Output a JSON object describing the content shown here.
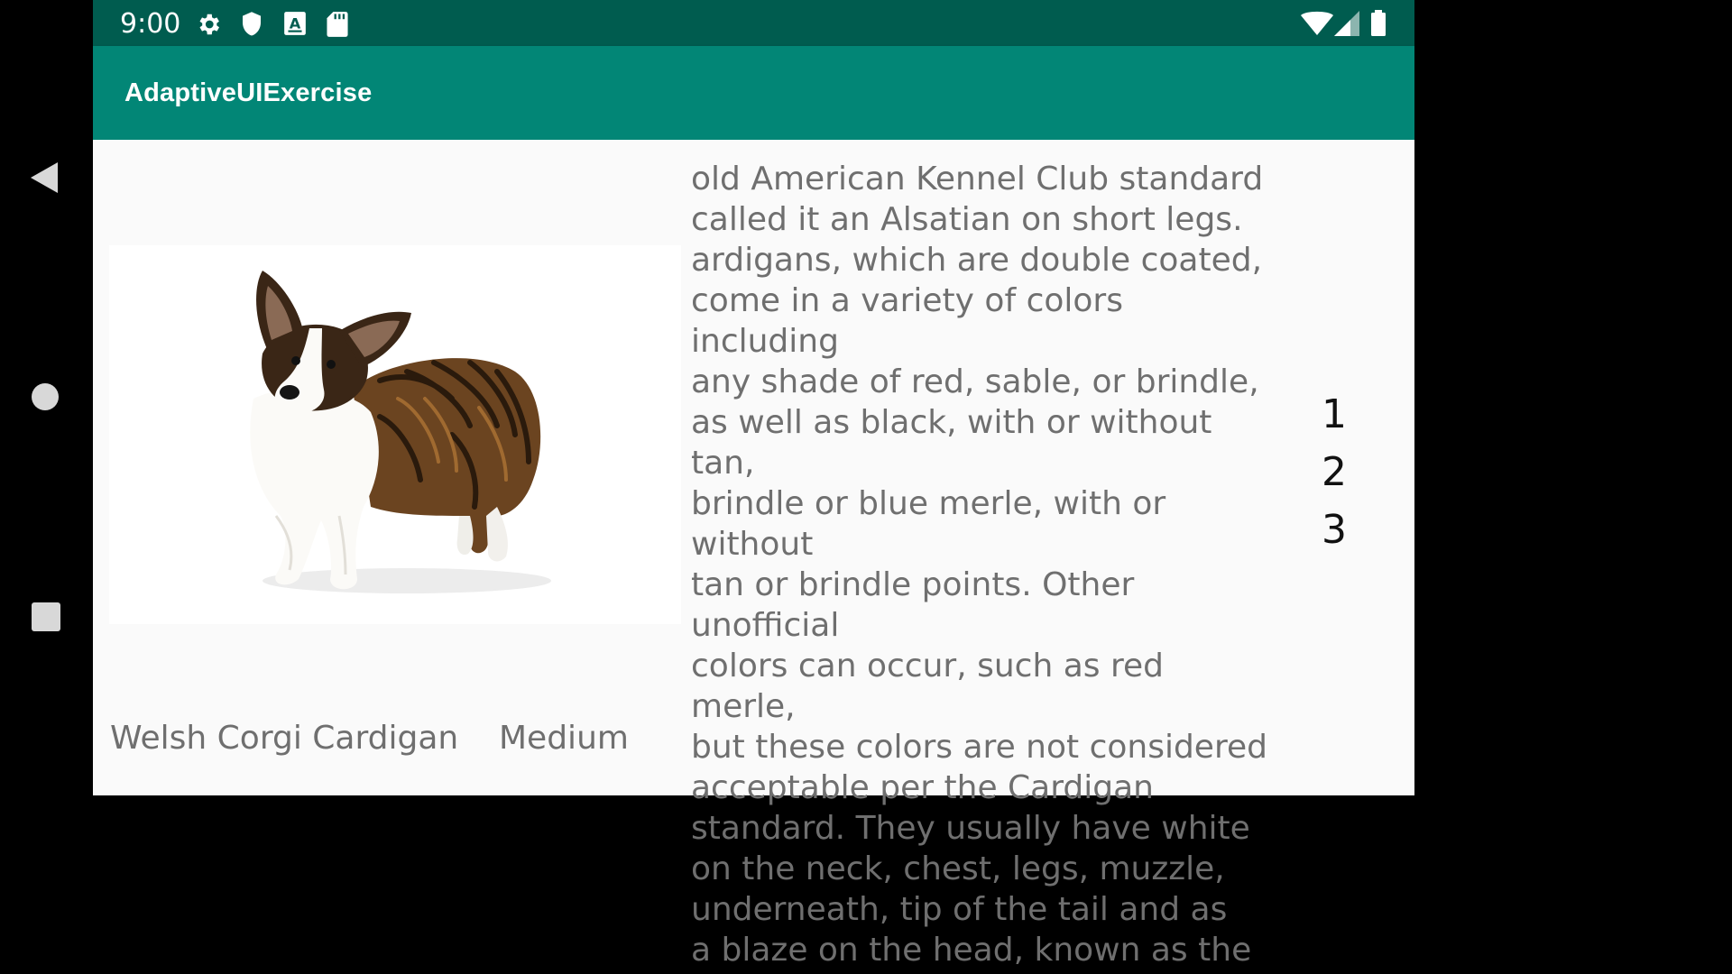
{
  "status_bar": {
    "time": "9:00",
    "left_icons": [
      "gear-icon",
      "shield-icon",
      "a-icon",
      "sd-card-icon"
    ],
    "right_icons": [
      "wifi-icon",
      "signal-icon",
      "battery-icon"
    ]
  },
  "navigation": {
    "buttons": [
      "back",
      "home",
      "recents"
    ]
  },
  "app_bar": {
    "title": "AdaptiveUIExercise",
    "color": "#028676"
  },
  "detail": {
    "image": "welsh-corgi-cardigan-photo",
    "breed_name": "Welsh Corgi Cardigan",
    "breed_size": "Medium",
    "description": "old American Kennel Club standard\ncalled it an Alsatian on short legs.\nardigans, which are double coated,\ncome in a variety of colors including\nany shade of red, sable, or brindle,\nas well as black, with or without tan,\nbrindle or blue merle, with or without\ntan or brindle points. Other unofficial\ncolors can occur, such as red merle,\nbut these colors are not considered\nacceptable per the Cardigan\nstandard. They usually have white\non the neck, chest, legs, muzzle,\nunderneath, tip of the tail and as\na blaze on the head, known as the",
    "numbers": [
      "1",
      "2",
      "3"
    ]
  },
  "colors": {
    "status_bar": "#005c4f",
    "app_bar": "#028676",
    "background": "#fafafa",
    "text": "#6f6f6f"
  }
}
